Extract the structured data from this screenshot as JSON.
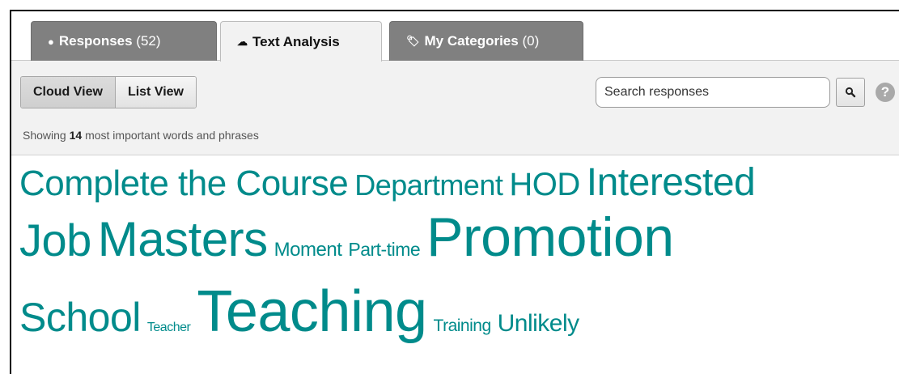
{
  "tabs": [
    {
      "label": "Responses",
      "count": "(52)",
      "icon": "speech-bubble-icon",
      "glyph": "●"
    },
    {
      "label": "Text Analysis",
      "count": "",
      "icon": "cloud-icon",
      "glyph": "☁"
    },
    {
      "label": "My Categories",
      "count": "(0)",
      "icon": "tag-icon",
      "glyph": "🏷"
    }
  ],
  "view_toggle": {
    "cloud": "Cloud View",
    "list": "List View"
  },
  "search": {
    "placeholder": "Search responses",
    "icon": "magnifier-icon"
  },
  "help_glyph": "?",
  "summary": {
    "prefix": "Showing",
    "count": "14",
    "suffix": "most important words and phrases"
  },
  "colors": {
    "word": "#008b8b",
    "tab_dark": "#808080"
  },
  "words": [
    "Complete the Course",
    "Department",
    "HOD",
    "Interested",
    "Job",
    "Masters",
    "Moment",
    "Part-time",
    "Promotion",
    "School",
    "Teacher",
    "Teaching",
    "Training",
    "Unlikely"
  ]
}
